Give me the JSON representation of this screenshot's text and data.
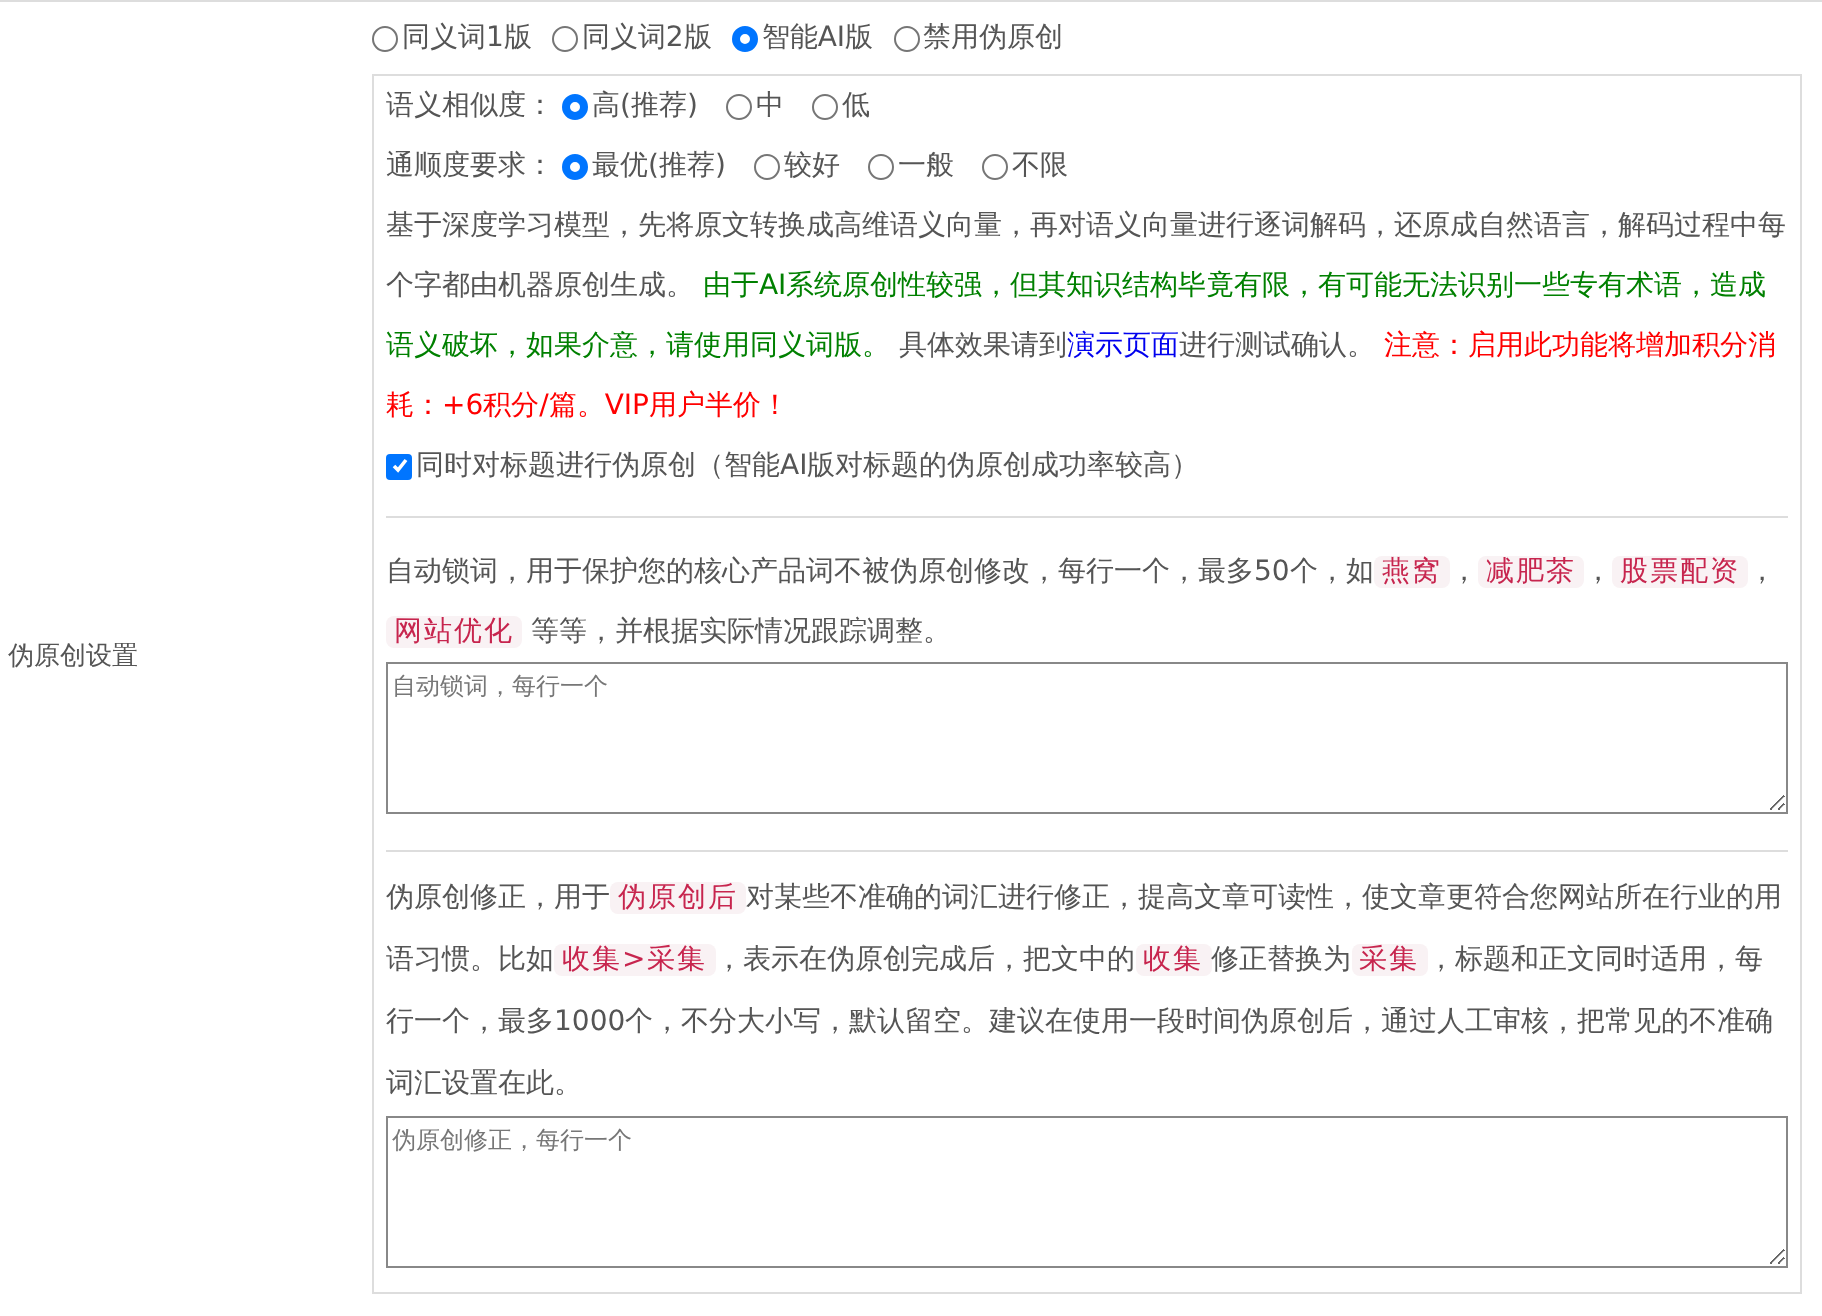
{
  "section_label": "伪原创设置",
  "modes": [
    {
      "label": "同义词1版",
      "selected": false
    },
    {
      "label": "同义词2版",
      "selected": false
    },
    {
      "label": "智能AI版",
      "selected": true
    },
    {
      "label": "禁用伪原创",
      "selected": false
    }
  ],
  "option_groups": [
    {
      "label": "语义相似度：",
      "options": [
        {
          "label": "高(推荐)",
          "selected": true
        },
        {
          "label": "中",
          "selected": false
        },
        {
          "label": "低",
          "selected": false
        }
      ]
    },
    {
      "label": "通顺度要求：",
      "options": [
        {
          "label": "最优(推荐)",
          "selected": true
        },
        {
          "label": "较好",
          "selected": false
        },
        {
          "label": "一般",
          "selected": false
        },
        {
          "label": "不限",
          "selected": false
        }
      ]
    }
  ],
  "ai_description": [
    {
      "kind": "plain",
      "text": "基于深度学习模型，先将原文转换成高维语义向量，再对语义向量进行逐词解码，还原成自然语言，解码过程中每个字都由机器原创生成。 "
    },
    {
      "kind": "green",
      "text": "由于AI系统原创性较强，但其知识结构毕竟有限，有可能无法识别一些专有术语，造成语义破坏，如果介意，请使用同义词版。"
    },
    {
      "kind": "plain",
      "text": " 具体效果请到"
    },
    {
      "kind": "link",
      "text": "演示页面"
    },
    {
      "kind": "plain",
      "text": "进行测试确认。 "
    },
    {
      "kind": "red",
      "text": "注意：启用此功能将增加积分消耗：+6积分/篇。VIP用户半价！"
    }
  ],
  "title_option": {
    "label": "同时对标题进行伪原创（智能AI版对标题的伪原创成功率较高）",
    "checked": true
  },
  "lock_words": {
    "description": [
      {
        "kind": "plain",
        "text": "自动锁词，用于保护您的核心产品词不被伪原创修改，每行一个，最多50个，如"
      },
      {
        "kind": "code",
        "text": "燕窝"
      },
      {
        "kind": "plain",
        "text": "，"
      },
      {
        "kind": "code",
        "text": "减肥茶"
      },
      {
        "kind": "plain",
        "text": "，"
      },
      {
        "kind": "code",
        "text": "股票配资"
      },
      {
        "kind": "plain",
        "text": "，"
      },
      {
        "kind": "code",
        "text": "网站优化"
      },
      {
        "kind": "plain",
        "text": " 等等，并根据实际情况跟踪调整。"
      }
    ],
    "placeholder": "自动锁词，每行一个"
  },
  "corrections": {
    "description": [
      {
        "kind": "plain",
        "text": "伪原创修正，用于"
      },
      {
        "kind": "code",
        "text": "伪原创后"
      },
      {
        "kind": "plain",
        "text": "对某些不准确的词汇进行修正，提高文章可读性，使文章更符合您网站所在行业的用语习惯。比如"
      },
      {
        "kind": "code",
        "text": "收集>采集"
      },
      {
        "kind": "plain",
        "text": "，表示在伪原创完成后，把文中的"
      },
      {
        "kind": "code",
        "text": "收集"
      },
      {
        "kind": "plain",
        "text": "修正替换为"
      },
      {
        "kind": "code",
        "text": "采集"
      },
      {
        "kind": "plain",
        "text": "，标题和正文同时适用，每行一个，最多1000个，不分大小写，默认留空。建议在使用一段时间伪原创后，通过人工审核，把常见的不准确词汇设置在此。"
      }
    ],
    "placeholder": "伪原创修正，每行一个"
  }
}
